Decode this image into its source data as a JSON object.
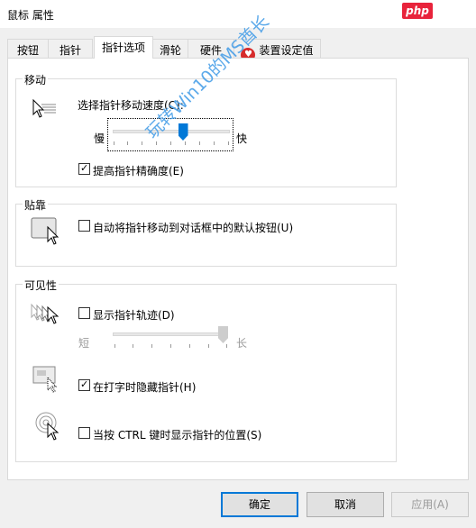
{
  "window": {
    "title": "鼠标 属性",
    "badge": "php"
  },
  "tabs": [
    {
      "label": "按钮"
    },
    {
      "label": "指针"
    },
    {
      "label": "指针选项",
      "active": true
    },
    {
      "label": "滑轮"
    },
    {
      "label": "硬件"
    },
    {
      "label": "装置设定值",
      "icon": "device-settings-icon"
    }
  ],
  "motion": {
    "legend": "移动",
    "speed_label": "选择指针移动速度(C):",
    "slow": "慢",
    "fast": "快",
    "speed_level": 0.6,
    "precision_label": "提高指针精确度(E)",
    "precision_checked": true
  },
  "snap": {
    "legend": "贴靠",
    "label": "自动将指针移动到对话框中的默认按钮(U)",
    "checked": false
  },
  "visibility": {
    "legend": "可见性",
    "trails_label": "显示指针轨迹(D)",
    "trails_checked": false,
    "short": "短",
    "long": "长",
    "trail_level": 1.0,
    "hide_label": "在打字时隐藏指针(H)",
    "hide_checked": true,
    "ctrl_label": "当按 CTRL 键时显示指针的位置(S)",
    "ctrl_checked": false
  },
  "watermark": "玩转Win10的MS酋长",
  "buttons": {
    "ok": "确定",
    "cancel": "取消",
    "apply": "应用(A)"
  },
  "colors": {
    "accent": "#0078d7",
    "badge": "#e8233b",
    "watermark": "#4aa0e8"
  }
}
